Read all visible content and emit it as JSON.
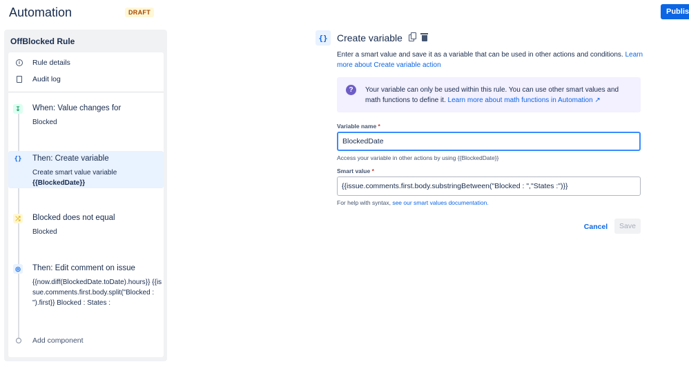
{
  "header": {
    "title": "Automation",
    "draft_badge": "DRAFT",
    "publish_label": "Publish"
  },
  "sidebar": {
    "rule_name": "OffBlocked Rule",
    "nav": [
      {
        "label": "Rule details",
        "icon": "info-icon"
      },
      {
        "label": "Audit log",
        "icon": "document-icon"
      }
    ],
    "components": [
      {
        "title": "When: Value changes for",
        "subtitle": "Blocked",
        "icon": "trigger-icon",
        "icon_color": "#22a06b"
      },
      {
        "title": "Then: Create variable",
        "subtitle": "Create smart value variable",
        "subtitle_bold": "{{BlockedDate}}",
        "icon": "braces-icon",
        "icon_color": "#0c66e4",
        "selected": true
      },
      {
        "title": "Blocked does not equal",
        "subtitle": "Blocked",
        "icon": "condition-icon",
        "icon_color": "#e2b203"
      },
      {
        "title": "Then: Edit comment on issue",
        "subtitle": "{{now.diff(BlockedDate.toDate).hours}} {{issue.comments.first.body.split(\"Blocked : \").first}} Blocked : States :",
        "icon": "comment-icon",
        "icon_color": "#0c66e4"
      }
    ],
    "add_component": "Add component"
  },
  "panel": {
    "icon_glyph": "{}",
    "title": "Create variable",
    "description": "Enter a smart value and save it as a variable that can be used in other actions and conditions.",
    "description_link": "Learn more about Create variable action",
    "info": {
      "text": "Your variable can only be used within this rule. You can use other smart values and math functions to define it.",
      "link": "Learn more about math functions in Automation ↗"
    },
    "variable_name": {
      "label": "Variable name",
      "required_mark": "*",
      "value": "BlockedDate",
      "helper": "Access your variable in other actions by using {{BlockedDate}}"
    },
    "smart_value": {
      "label": "Smart value",
      "required_mark": "*",
      "value": "{{issue.comments.first.body.substringBetween(\"Blocked : \",\"States :\")}}",
      "helper_prefix": "For help with syntax,",
      "helper_link": "see our smart values documentation."
    },
    "cancel_label": "Cancel",
    "save_label": "Save"
  }
}
